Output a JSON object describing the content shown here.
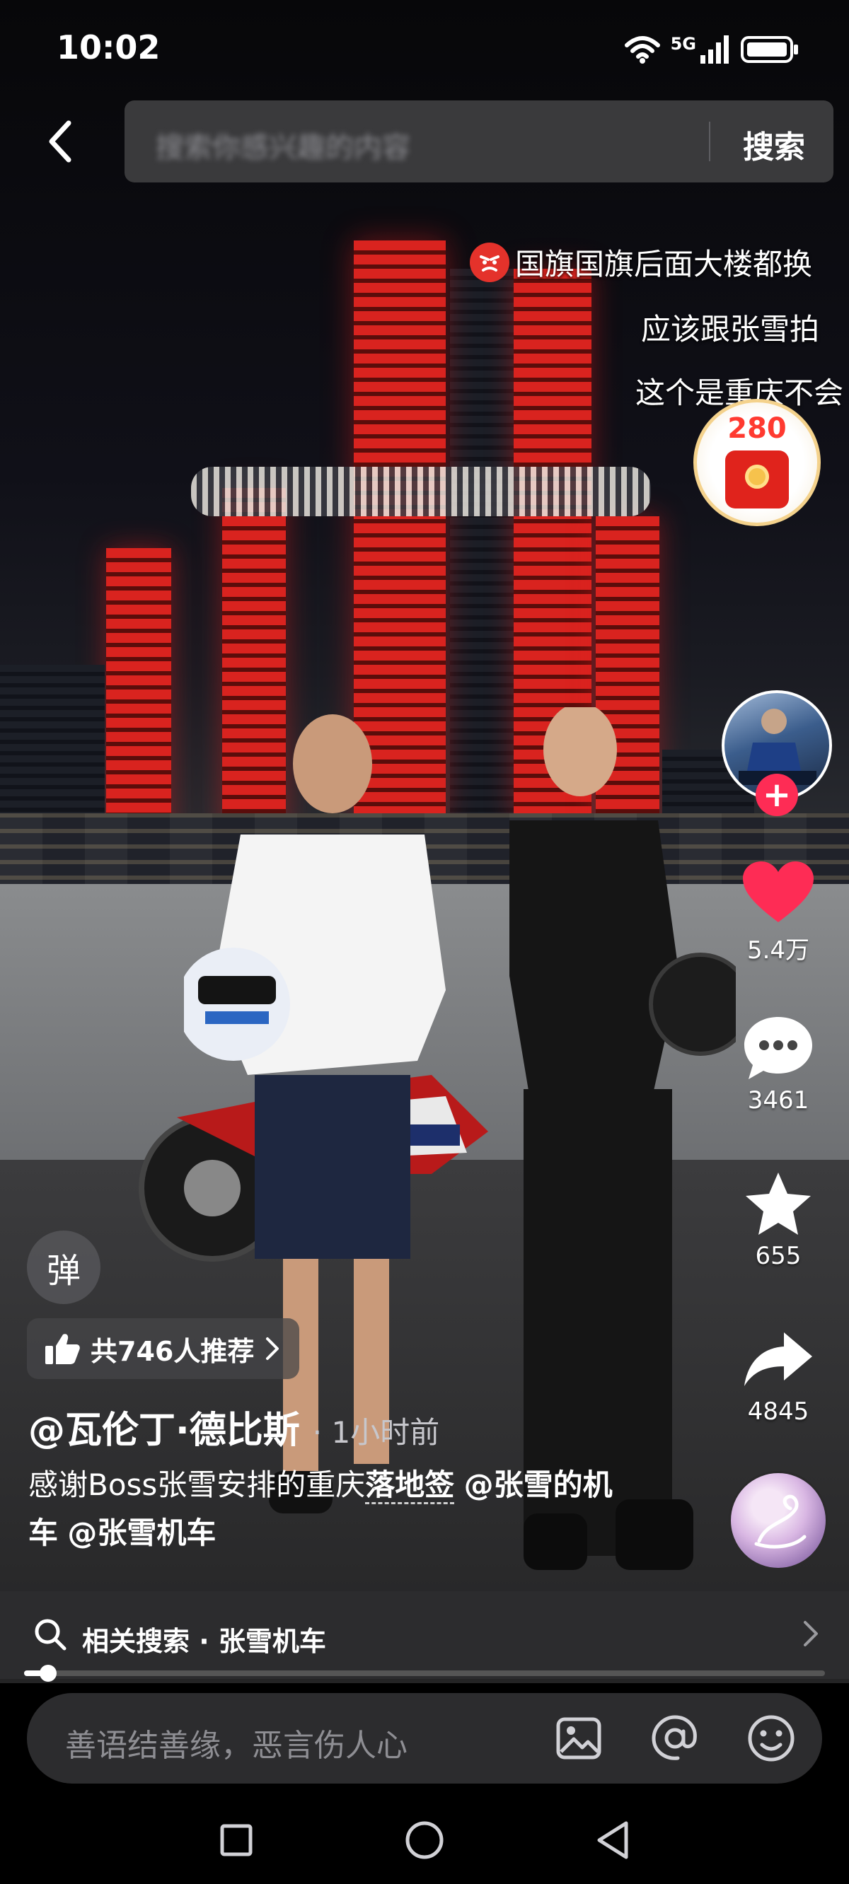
{
  "status_bar": {
    "time": "10:02",
    "network": "5G"
  },
  "search": {
    "placeholder": "搜索你感兴趣的内容",
    "button_label": "搜索"
  },
  "danmaku": [
    {
      "text": "国旗国旗后面大楼都换",
      "has_emoji": true
    },
    {
      "text": "应该跟张雪拍"
    },
    {
      "text": "这个是重庆不会"
    }
  ],
  "red_packet": {
    "count": "280"
  },
  "right_rail": {
    "like_count": "5.4万",
    "comment_count": "3461",
    "favorite_count": "655",
    "share_count": "4845"
  },
  "danmaku_toggle": {
    "label": "弹"
  },
  "recommend": {
    "label": "共746人推荐"
  },
  "post": {
    "author": "@瓦伦丁·德比斯",
    "time": "· 1小时前",
    "caption_prefix": "感谢Boss张雪安排的重庆",
    "caption_keyword": "落地签",
    "caption_tag1": "@张雪的机车",
    "caption_tag2": "@张雪机车"
  },
  "related_search": {
    "label": "相关搜索 · 张雪机车"
  },
  "progress": {
    "value_fraction": 0.03
  },
  "comment_box": {
    "placeholder": "善语结善缘，恶言伤人心"
  },
  "colors": {
    "accent": "#fe2c55",
    "like": "#fe2c55",
    "tower_red": "#d9231f"
  }
}
